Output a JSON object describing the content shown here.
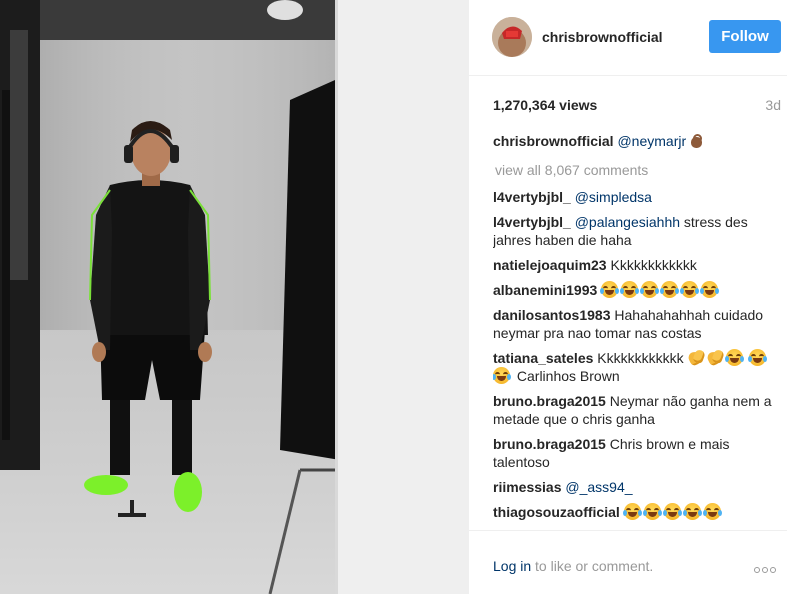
{
  "header": {
    "username": "chrisbrownofficial",
    "follow_label": "Follow"
  },
  "stats": {
    "views": "1,270,364 views",
    "age": "3d"
  },
  "caption": {
    "user": "chrisbrownofficial",
    "text": "@neymarjr",
    "icon": "ok-hand-emoji"
  },
  "view_all": "view all 8,067 comments",
  "comments": [
    {
      "user": "l4vertybjbl_",
      "text": "@simpledsa"
    },
    {
      "user": "l4vertybjbl_",
      "mention": "@palangesiahhh",
      "text": " stress des jahres haben die haha"
    },
    {
      "user": "natielejoaquim23",
      "text": "Kkkkkkkkkkkk"
    },
    {
      "user": "albanemini1993",
      "text": "",
      "icon": "tears-of-joy-emoji x6"
    },
    {
      "user": "danilosantos1983",
      "text": "Hahahahahhah cuidado neymar pra nao tomar nas costas"
    },
    {
      "user": "tatiana_sateles",
      "text": "Kkkkkkkkkkkk",
      "text2": "Carlinhos Brown",
      "icon": "clapping-hands-emoji, tears-of-joy-emoji"
    },
    {
      "user": "bruno.braga2015",
      "text": "Neymar não ganha nem a metade que o chris ganha"
    },
    {
      "user": "bruno.braga2015",
      "text": "Chris brown e mais talentoso"
    },
    {
      "user": "riimessias",
      "text": "@_ass94_"
    },
    {
      "user": "thiagosouzaofficial",
      "text": ""
    }
  ],
  "footer": {
    "login": "Log in",
    "rest": " to like or comment.",
    "more_icon": "more-options-icon"
  },
  "colors": {
    "follow_blue": "#3897f0",
    "link_navy": "#003569",
    "muted": "#999999"
  }
}
